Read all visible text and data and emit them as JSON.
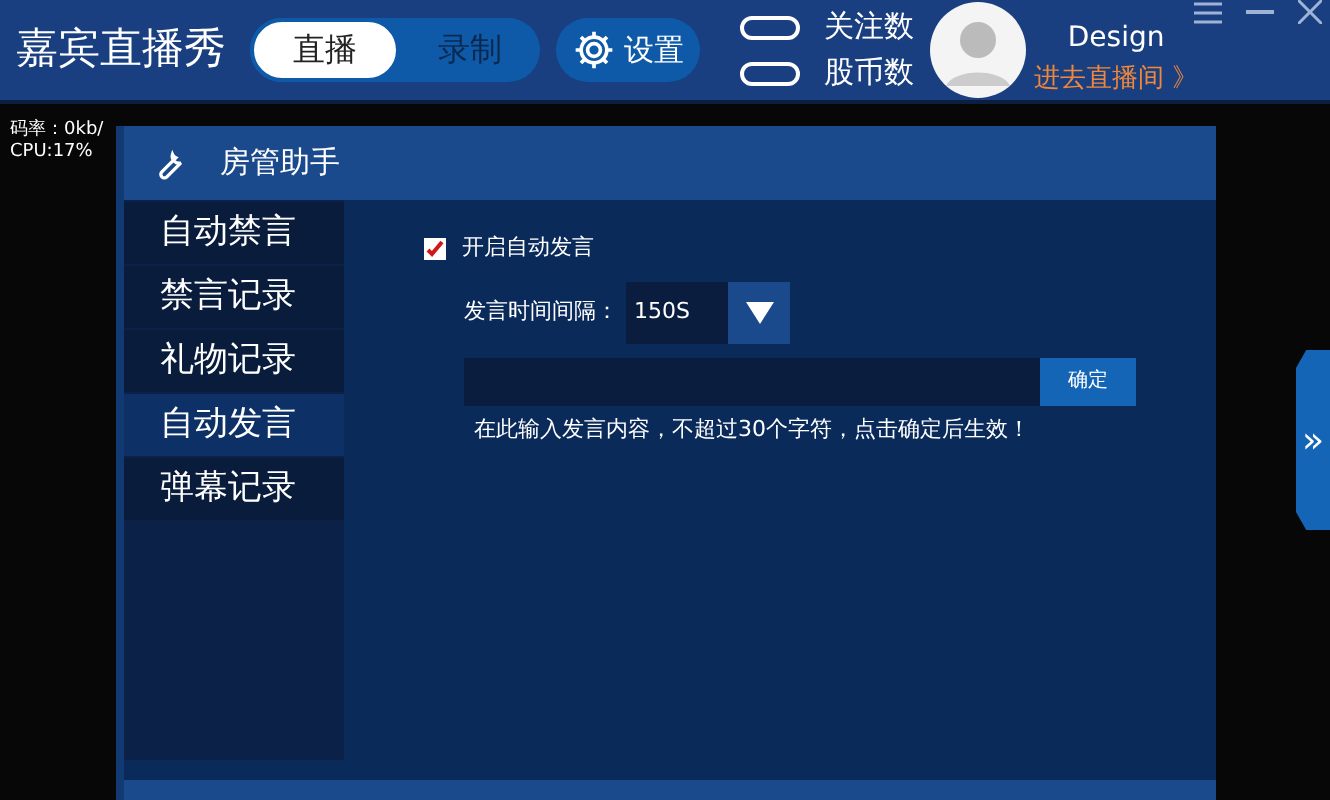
{
  "app": {
    "title": "嘉宾直播秀"
  },
  "mode_tabs": [
    {
      "label": "直播",
      "selected": true
    },
    {
      "label": "录制",
      "selected": false
    }
  ],
  "settings": {
    "label": "设置"
  },
  "stats": [
    {
      "label": "关注数"
    },
    {
      "label": "股币数"
    }
  ],
  "user": {
    "name": "Design",
    "link": "进去直播间 》"
  },
  "overlay": [
    "码率：0kb/",
    "CPU:17%"
  ],
  "dialog": {
    "title": "房管助手",
    "sidebar": [
      {
        "label": "自动禁言",
        "selected": false
      },
      {
        "label": "禁言记录",
        "selected": false
      },
      {
        "label": "礼物记录",
        "selected": false
      },
      {
        "label": "自动发言",
        "selected": true
      },
      {
        "label": "弹幕记录",
        "selected": false
      }
    ],
    "auto_speak": {
      "label": "开启自动发言",
      "checked": true
    },
    "interval": {
      "label": "发言时间间隔：",
      "value": "150S"
    },
    "confirm": {
      "label": "确定"
    },
    "hint": "在此输入发言内容，不超过30个字符，点击确定后生效！"
  },
  "expand_tab": {
    "label": "»"
  }
}
